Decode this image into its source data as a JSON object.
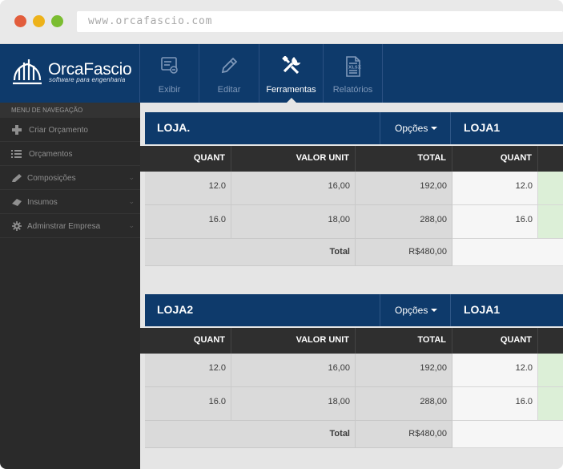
{
  "browser": {
    "url": "www.orcafascio.com"
  },
  "brand": {
    "name": "OrcaFascio",
    "tagline": "software para engenharia",
    "color": "#0e3a6b"
  },
  "toolbar": {
    "items": [
      {
        "label": "Exibir",
        "icon": "display-icon",
        "active": false
      },
      {
        "label": "Editar",
        "icon": "pencil-icon",
        "active": false
      },
      {
        "label": "Ferramentas",
        "icon": "tools-icon",
        "active": true
      },
      {
        "label": "Relatórios",
        "icon": "xlsx-file-icon",
        "active": false
      }
    ]
  },
  "sidebar": {
    "heading": "MENU DE NAVEGAÇÃO",
    "items": [
      {
        "label": "Criar Orçamento",
        "icon": "plus-icon",
        "expandable": false
      },
      {
        "label": "Orçamentos",
        "icon": "list-icon",
        "expandable": false
      },
      {
        "label": "Composições",
        "icon": "pencil-icon",
        "expandable": true
      },
      {
        "label": "Insumos",
        "icon": "eraser-icon",
        "expandable": true
      },
      {
        "label": "Adminstrar Empresa",
        "icon": "gear-icon",
        "expandable": true
      }
    ]
  },
  "columns": {
    "quant": "QUANT",
    "valor_unit": "VALOR UNIT",
    "total": "TOTAL"
  },
  "blocks": [
    {
      "name": "LOJA.",
      "options_label": "Opções",
      "next_name": "LOJA1",
      "rows": [
        {
          "quant": "12.0",
          "valor_unit": "16,00",
          "total": "192,00",
          "next_quant": "12.0"
        },
        {
          "quant": "16.0",
          "valor_unit": "18,00",
          "total": "288,00",
          "next_quant": "16.0"
        }
      ],
      "total_label": "Total",
      "total_value": "R$480,00"
    },
    {
      "name": "LOJA2",
      "options_label": "Opções",
      "next_name": "LOJA1",
      "rows": [
        {
          "quant": "12.0",
          "valor_unit": "16,00",
          "total": "192,00",
          "next_quant": "12.0"
        },
        {
          "quant": "16.0",
          "valor_unit": "18,00",
          "total": "288,00",
          "next_quant": "16.0"
        }
      ],
      "total_label": "Total",
      "total_value": "R$480,00"
    }
  ]
}
